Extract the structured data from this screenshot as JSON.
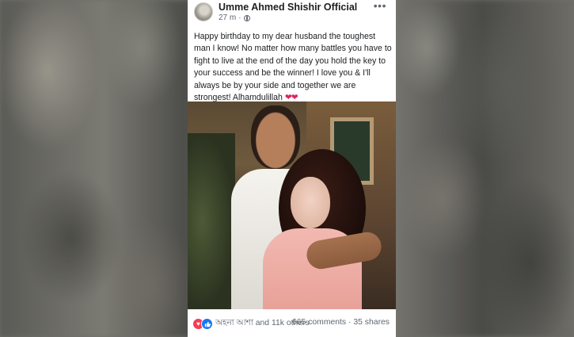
{
  "post": {
    "author": "Umme Ahmed  Shishir Official",
    "time": "27 m",
    "time_sep": "·",
    "more_icon": "more-icon",
    "privacy_icon": "globe-icon",
    "text": "Happy birthday to my dear husband the toughest man I know! No matter how many battles you have to fight to live at the end of the day you hold the key to your success and be the winner! I love you & I'll always be by your side and together we are strongest! Alhamdulillah ",
    "emoji": "❤❤"
  },
  "footer": {
    "love_glyph": "♥",
    "like_glyph": "👍",
    "reactions_text": "অহনা আশা and 11k others",
    "counts_text": "665 comments · 35 shares"
  },
  "colors": {
    "love": "#f33e58",
    "like": "#1877f2",
    "meta_text": "#606770"
  }
}
